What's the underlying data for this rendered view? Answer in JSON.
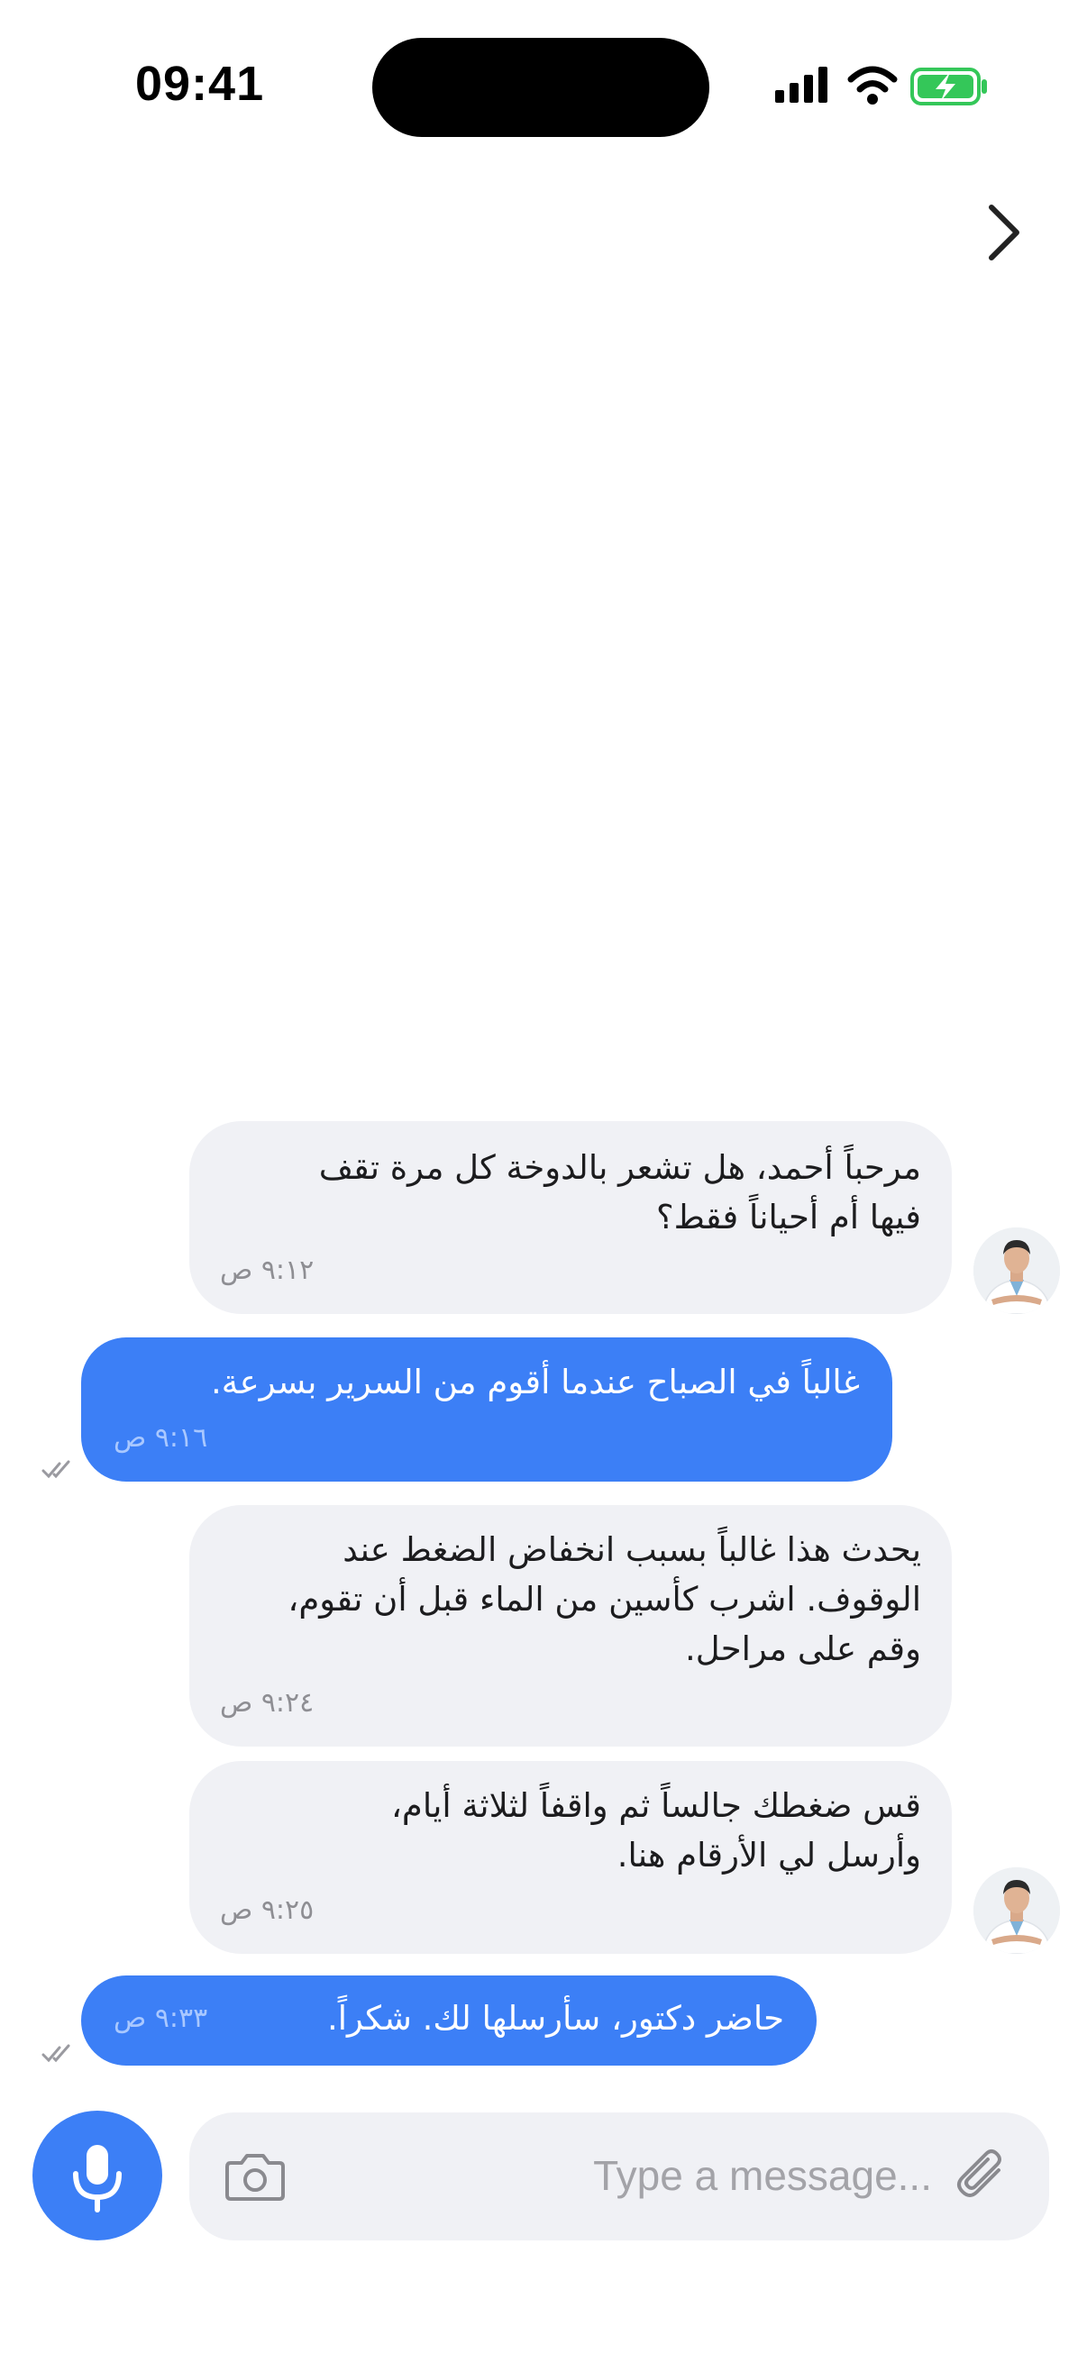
{
  "status_bar": {
    "time": "09:41"
  },
  "messages": [
    {
      "side": "in",
      "lines": [
        "مرحباً أحمد، هل تشعر بالدوخة كل مرة تقف",
        "فيها أم أحياناً فقط؟"
      ],
      "time": "٩:١٢ ص",
      "avatar": true
    },
    {
      "side": "out",
      "lines": [
        "غالباً في الصباح عندما أقوم من السرير بسرعة."
      ],
      "time": "٩:١٦ ص",
      "read": true
    },
    {
      "side": "in",
      "lines": [
        "يحدث هذا غالباً بسبب انخفاض الضغط عند",
        "الوقوف. اشرب كأسين من الماء قبل أن تقوم،",
        "وقم على مراحل."
      ],
      "time": "٩:٢٤ ص",
      "avatar": false
    },
    {
      "side": "in",
      "lines": [
        "قس ضغطك جالساً ثم واقفاً لثلاثة أيام،",
        "وأرسل لي الأرقام هنا."
      ],
      "time": "٩:٢٥ ص",
      "avatar": true
    },
    {
      "side": "out",
      "lines": [
        "حاضر دكتور، سأرسلها لك. شكراً."
      ],
      "time": "٩:٣٣ ص",
      "read": true
    }
  ],
  "composer": {
    "placeholder": "Type a message..."
  },
  "colors": {
    "accent": "#3c7ff6",
    "incoming_bubble": "#f0f1f5",
    "battery": "#34c759"
  },
  "icons": {
    "back": "chevron-right-icon",
    "mic": "microphone-icon",
    "camera": "camera-icon",
    "attach": "paperclip-icon"
  }
}
